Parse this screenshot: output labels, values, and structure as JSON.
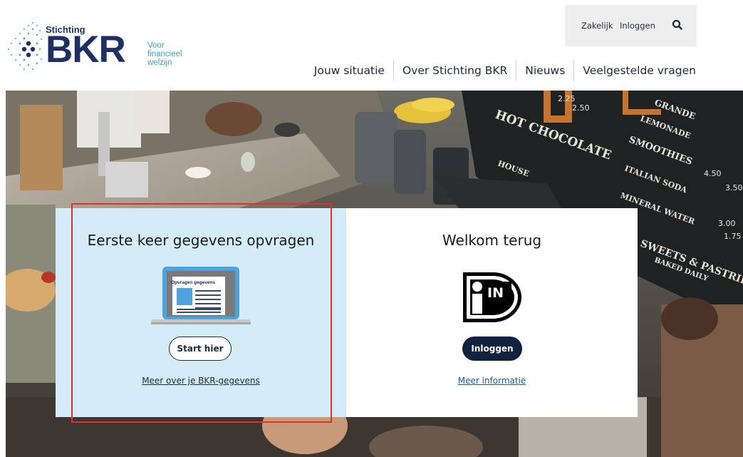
{
  "logo": {
    "small": "Stichting",
    "big": "BKR",
    "tagline": [
      "Voor",
      "financieel",
      "welzijn"
    ]
  },
  "utility": {
    "zakelijk": "Zakelijk",
    "inloggen": "Inloggen",
    "search_icon": "search-icon"
  },
  "nav": {
    "items": [
      "Jouw situatie",
      "Over Stichting BKR",
      "Nieuws",
      "Veelgestelde vragen"
    ]
  },
  "hero": {
    "board_text": [
      "HOT CHOCOLATE",
      "SMOOTHIES",
      "ITALIAN SODA",
      "MINERAL WATER",
      "SWEETS & PASTRIES",
      "BAKED DAILY",
      "GRANDE",
      "LEMONADE",
      "HOUSE"
    ],
    "board_prices": [
      "2.25",
      "3.50",
      "4.50",
      "3.00",
      "1.75",
      "2.50"
    ]
  },
  "card_left": {
    "title": "Eerste keer gegevens opvragen",
    "laptop_label": "Opvragen gegevens",
    "button": "Start hier",
    "link": "Meer over je BKR-gegevens"
  },
  "card_right": {
    "title": "Welkom terug",
    "idin_text": "IN",
    "button": "Inloggen",
    "link": "Meer informatie"
  },
  "colors": {
    "brand_navy": "#1d2f63",
    "brand_blue": "#3aa3d6",
    "left_card_bg": "#d3ecf8",
    "dark_button": "#0f2340",
    "highlight": "#e03030",
    "link_blue": "#1a59b3"
  }
}
